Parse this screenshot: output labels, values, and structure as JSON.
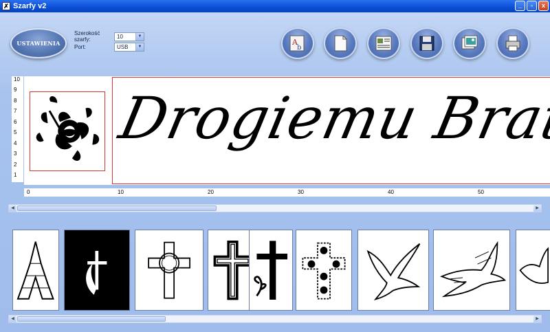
{
  "window": {
    "title": "Szarfy v2",
    "controls": [
      "_",
      "▫",
      "x"
    ]
  },
  "settings": {
    "button_label": "USTAWIENIA",
    "width_label": "Szerokość szarfy:",
    "width_value": "10",
    "port_label": "Port:",
    "port_value": "USB"
  },
  "toolbar": {
    "buttons": [
      {
        "name": "font-icon"
      },
      {
        "name": "new-document-icon"
      },
      {
        "name": "open-template-icon"
      },
      {
        "name": "save-disk-icon"
      },
      {
        "name": "image-library-icon"
      },
      {
        "name": "printer-icon"
      }
    ]
  },
  "preview": {
    "text": "Drogiemu Bratu",
    "vertical_ruler": [
      "10",
      "9",
      "8",
      "7",
      "6",
      "5",
      "4",
      "3",
      "2",
      "1"
    ],
    "horizontal_ruler": [
      "0",
      "10",
      "20",
      "30",
      "40",
      "50"
    ],
    "emblem": "rose-icon"
  },
  "gallery": {
    "items": [
      "praying-hands-icon",
      "cross-flame-icon",
      "celtic-cross-icon",
      "outline-cross-icon",
      "cross-lily-icon",
      "flower-cross-icon",
      "dove-icon",
      "dove-branch-icon",
      "dove-partial-icon"
    ]
  }
}
